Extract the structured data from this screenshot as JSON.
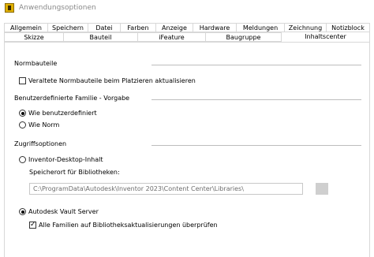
{
  "window": {
    "title": "Anwendungsoptionen"
  },
  "tabs_row1": [
    "Allgemein",
    "Speichern",
    "Datei",
    "Farben",
    "Anzeige",
    "Hardware",
    "Meldungen",
    "Zeichnung",
    "Notizblock"
  ],
  "tabs_row2": [
    "Skizze",
    "Bauteil",
    "iFeature",
    "Baugruppe",
    "Inhaltscenter"
  ],
  "active_tab": "Inhaltscenter",
  "sections": {
    "normbauteile": {
      "title": "Normbauteile",
      "checkbox_label": "Veraltete Normbauteile beim Platzieren aktualisieren",
      "checked": false
    },
    "familie": {
      "title": "Benutzerdefinierte Familie - Vorgabe",
      "options": [
        "Wie benutzerdefiniert",
        "Wie Norm"
      ],
      "selected": "Wie benutzerdefiniert"
    },
    "zugriff": {
      "title": "Zugriffsoptionen",
      "option_desktop": "Inventor-Desktop-Inhalt",
      "speicherort_label": "Speicherort für Bibliotheken:",
      "speicherort_value": "C:\\ProgramData\\Autodesk\\Inventor 2023\\Content Center\\Libraries\\",
      "option_vault": "Autodesk Vault Server",
      "selected": "Autodesk Vault Server",
      "checkbox_label": "Alle Familien auf Bibliotheksaktualisierungen überprüfen",
      "checked": true
    }
  }
}
